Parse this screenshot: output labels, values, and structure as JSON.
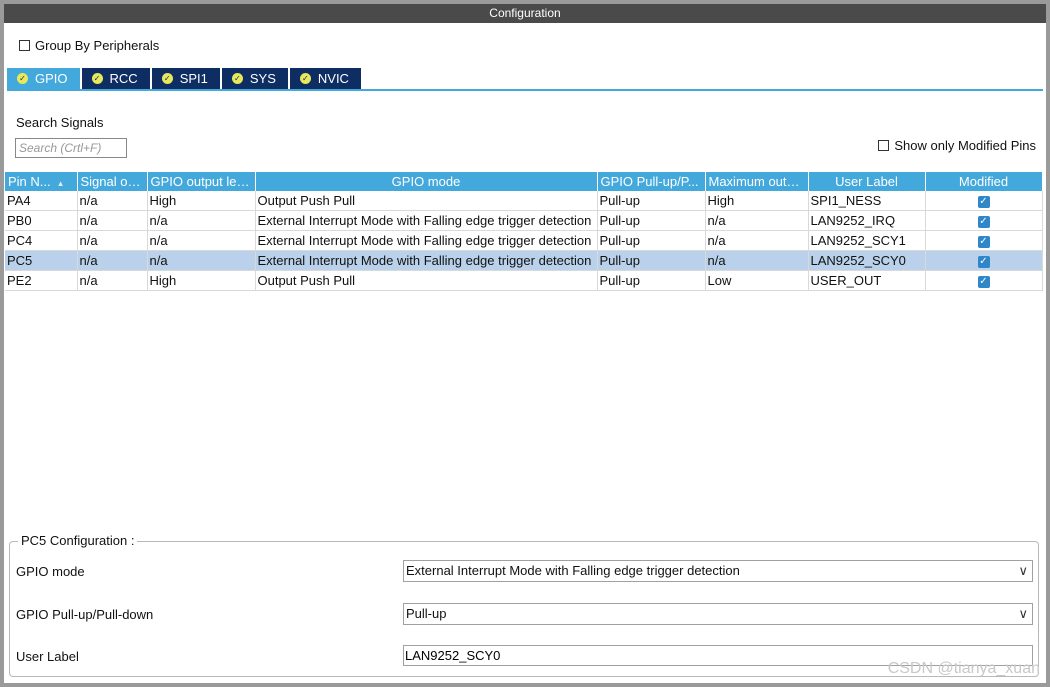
{
  "window": {
    "title": "Configuration"
  },
  "group_by": {
    "label": "Group By Peripherals"
  },
  "tabs": [
    {
      "label": "GPIO",
      "active": true
    },
    {
      "label": "RCC"
    },
    {
      "label": "SPI1"
    },
    {
      "label": "SYS"
    },
    {
      "label": "NVIC"
    }
  ],
  "search": {
    "label": "Search Signals",
    "placeholder": "Search (Crtl+F)"
  },
  "show_modified": {
    "label": "Show only Modified Pins"
  },
  "table": {
    "headers": [
      "Pin N...",
      "Signal on...",
      "GPIO output level",
      "GPIO mode",
      "GPIO Pull-up/P...",
      "Maximum outp...",
      "User Label",
      "Modified"
    ],
    "rows": [
      [
        "PA4",
        "n/a",
        "High",
        "Output Push Pull",
        "Pull-up",
        "High",
        "SPI1_NESS",
        true
      ],
      [
        "PB0",
        "n/a",
        "n/a",
        "External Interrupt Mode with Falling edge trigger detection",
        "Pull-up",
        "n/a",
        "LAN9252_IRQ",
        true
      ],
      [
        "PC4",
        "n/a",
        "n/a",
        "External Interrupt Mode with Falling edge trigger detection",
        "Pull-up",
        "n/a",
        "LAN9252_SCY1",
        true
      ],
      [
        "PC5",
        "n/a",
        "n/a",
        "External Interrupt Mode with Falling edge trigger detection",
        "Pull-up",
        "n/a",
        "LAN9252_SCY0",
        true
      ],
      [
        "PE2",
        "n/a",
        "High",
        "Output Push Pull",
        "Pull-up",
        "Low",
        "USER_OUT",
        true
      ]
    ],
    "selected_row": 3
  },
  "pin_config": {
    "title": "PC5 Configuration :",
    "gpio_mode_label": "GPIO mode",
    "gpio_mode_value": "External Interrupt Mode with Falling edge trigger detection",
    "pull_label": "GPIO Pull-up/Pull-down",
    "pull_value": "Pull-up",
    "user_label_label": "User Label",
    "user_label_value": "LAN9252_SCY0"
  },
  "watermark": "CSDN @tianya_xuan",
  "colors": {
    "tab_active": "#43a8db",
    "tab_inactive": "#0d2d63",
    "header": "#43a8db",
    "selected_row": "#b9d1ea"
  }
}
